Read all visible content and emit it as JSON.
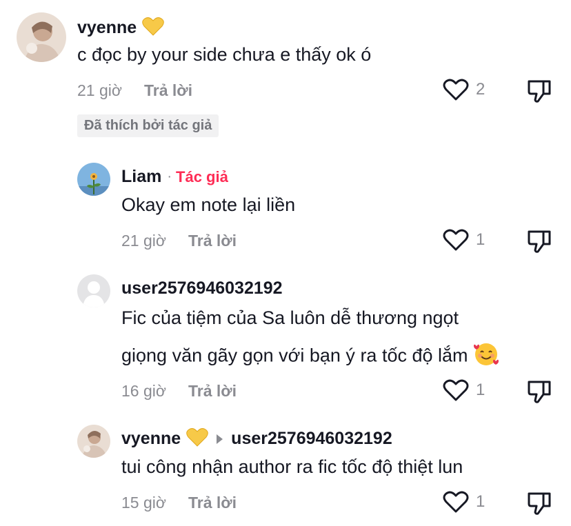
{
  "comments": [
    {
      "username": "vyenne",
      "text": "c đọc by your side chưa e thấy ok ó",
      "time": "21 giờ",
      "reply_label": "Trả lời",
      "likes": "2",
      "liked_by_author": "Đã thích bởi tác giả"
    },
    {
      "username": "Liam",
      "author_tag": "Tác giả",
      "text": "Okay em note lại liền",
      "time": "21 giờ",
      "reply_label": "Trả lời",
      "likes": "1"
    },
    {
      "username": "user2576946032192",
      "text_line1": "Fic của tiệm của Sa luôn dễ thương ngọt",
      "text_line2": "giọng văn gãy gọn với bạn ý ra tốc độ lắm",
      "time": "16 giờ",
      "reply_label": "Trả lời",
      "likes": "1"
    },
    {
      "username": "vyenne",
      "reply_to": "user2576946032192",
      "text": "tui công nhận author ra fic tốc độ thiệt lun",
      "time": "15 giờ",
      "reply_label": "Trả lời",
      "likes": "1"
    }
  ],
  "colors": {
    "author_tag": "#fe2c55",
    "muted": "#8a8b91",
    "text": "#161823",
    "badge_bg": "#f1f1f2"
  }
}
